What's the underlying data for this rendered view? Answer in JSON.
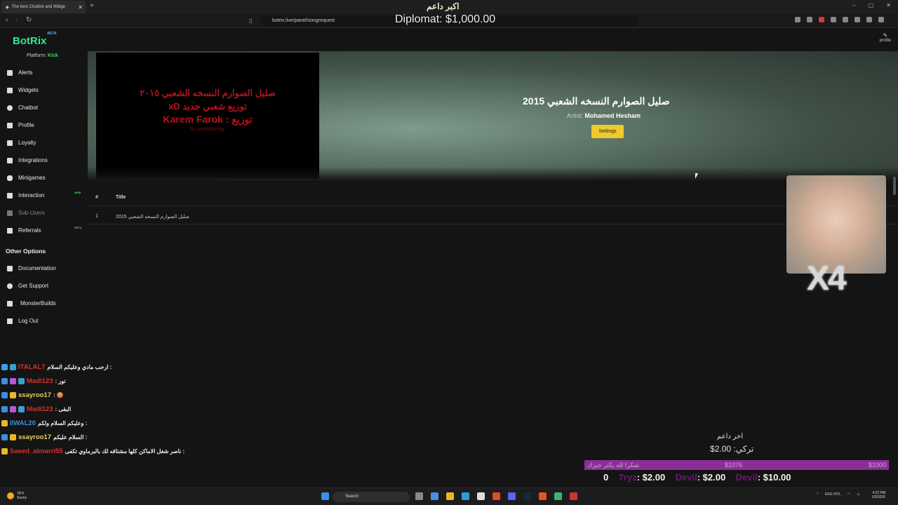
{
  "browser": {
    "tab_title": "The best Chatbot and Widge",
    "url": "botrix.live/panel/songrequest",
    "window_controls": [
      "–",
      "▢",
      "✕"
    ]
  },
  "sidebar": {
    "logo": "BotRix",
    "logo_badge": "BETA",
    "platform_label": "Platform:",
    "platform_value": "Kick",
    "items": [
      {
        "label": "Alerts",
        "icon": "bell-icon"
      },
      {
        "label": "Widgets",
        "icon": "widgets-icon"
      },
      {
        "label": "Chatbot",
        "icon": "chat-icon"
      },
      {
        "label": "Profile",
        "icon": "user-icon"
      },
      {
        "label": "Loyalty",
        "icon": "trophy-icon"
      },
      {
        "label": "Integrations",
        "icon": "plug-icon"
      },
      {
        "label": "Minigames",
        "icon": "gamepad-icon"
      },
      {
        "label": "Interaction",
        "icon": "interaction-icon",
        "badge": "NEW"
      },
      {
        "label": "Sub-Users",
        "icon": "users-icon"
      },
      {
        "label": "Referrals",
        "icon": "referral-icon",
        "badge": "BETA"
      }
    ],
    "other_options_title": "Other Options",
    "other_items": [
      {
        "label": "Documentation",
        "icon": "doc-icon"
      },
      {
        "label": "Get Support",
        "icon": "help-icon"
      },
      {
        "label": "MonsterBuilds",
        "icon": "monitor-icon",
        "badge": "___"
      },
      {
        "label": "Log Out",
        "icon": "logout-icon"
      }
    ]
  },
  "header": {
    "profile_label": "profile"
  },
  "player": {
    "video_line1": "صليل الصوارم النسخه الشعبي ٢٠١٥",
    "video_line2": "توزيع شعبي جديد xD",
    "video_line3": "توزيع : Karem Farok",
    "video_line4": "fb.com/sBw.egy",
    "song_title": "صليل الصوارم النسخه الشعبي 2015",
    "artist_label": "Artist:",
    "artist_name": "Mohamed Hesham",
    "settings_label": "Settings"
  },
  "queue": {
    "headers": [
      "#",
      "Title"
    ],
    "rows": [
      {
        "num": "1",
        "title": "صليل الصوارم النسخه الشعبي 2015"
      }
    ]
  },
  "overlay": {
    "donor_name": "اكبر داعم",
    "donor_amount": "Diplomat: $1,000.00",
    "webcam_text": "X4",
    "last_donor_label": "اخر داعم",
    "last_donor_amount": "تركي: 2.00$",
    "goal_text": "شكرا لله يكثر خيرك",
    "goal_current": "$1076",
    "goal_target": "$1000",
    "goal_progress": 1.0,
    "top_donors": [
      {
        "name": "0",
        "amount": ""
      },
      {
        "name": "7ryz",
        "amount": ": $2.00"
      },
      {
        "name": "Devil",
        "amount": ": $2.00"
      },
      {
        "name": "Devil",
        "amount": ": $10.00"
      }
    ]
  },
  "chat": [
    {
      "user": "ITALAL7",
      "color": "#d9302f",
      "text": "ارحب مادي وعليكم السلام :",
      "badges": [
        "#3ba0e0",
        "#39a0d0"
      ]
    },
    {
      "user": "Madi123",
      "color": "#d9302f",
      "text": ": تور",
      "badges": [
        "#3a8fe0",
        "#b45ad6",
        "#39a0d0"
      ]
    },
    {
      "user": "ssayroo17",
      "color": "#e8d060",
      "text": ": 🍪",
      "badges": [
        "#3a8fe0",
        "#e8b923"
      ]
    },
    {
      "user": "Madi123",
      "color": "#d9302f",
      "text": ": البقى",
      "badges": [
        "#3a8fe0",
        "#b45ad6",
        "#39a0d0"
      ]
    },
    {
      "user": "IIWAL20",
      "color": "#3a8fe0",
      "text": "وعليكم السلام ولكم :",
      "badges": [
        "#e8b923"
      ]
    },
    {
      "user": "ssayroo17",
      "color": "#e8d060",
      "text": "السلام عليكم :",
      "badges": [
        "#3a8fe0",
        "#e8b923"
      ]
    },
    {
      "user": "Saeed_almarri55",
      "color": "#d9302f",
      "text": "ناصر شغل الاماكن كلها مشتاقه لك بالبرماوي تكفى :",
      "badges": [
        "#e8b923"
      ]
    }
  ],
  "taskbar": {
    "weather_temp": "78°F",
    "weather_desc": "Sunny",
    "search_label": "Search",
    "lang": "ENG INTL",
    "time": "4:22 PM",
    "date": "1/5/2026"
  },
  "colors": {
    "brand": "#2ee88f",
    "accent_button": "#f0c92b",
    "goal_bar": "#8b2f96"
  }
}
